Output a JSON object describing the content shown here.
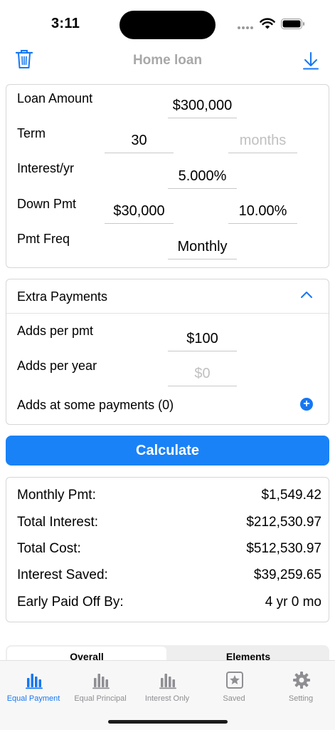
{
  "status_bar": {
    "time": "3:11"
  },
  "nav": {
    "title": "Home loan"
  },
  "loan": {
    "amount_label": "Loan Amount",
    "amount_value": "$300,000",
    "term_label": "Term",
    "term_value": "30",
    "term_months_placeholder": "months",
    "interest_label": "Interest/yr",
    "interest_value": "5.000%",
    "down_label": "Down Pmt",
    "down_amount": "$30,000",
    "down_percent": "10.00%",
    "freq_label": "Pmt Freq",
    "freq_value": "Monthly"
  },
  "extra": {
    "title": "Extra Payments",
    "per_pmt_label": "Adds per pmt",
    "per_pmt_value": "$100",
    "per_year_label": "Adds per year",
    "per_year_placeholder": "$0",
    "some_payments_label": "Adds at some payments (0)"
  },
  "calculate_label": "Calculate",
  "results": [
    {
      "label": "Monthly Pmt:",
      "value": "$1,549.42"
    },
    {
      "label": "Total Interest:",
      "value": "$212,530.97"
    },
    {
      "label": "Total Cost:",
      "value": "$512,530.97"
    },
    {
      "label": "Interest Saved:",
      "value": "$39,259.65"
    },
    {
      "label": "Early Paid Off By:",
      "value": "4 yr 0 mo"
    }
  ],
  "segments": {
    "overall": "Overall",
    "elements": "Elements"
  },
  "tabs": [
    {
      "label": "Equal Payment",
      "icon": "bar-chart-icon"
    },
    {
      "label": "Equal Principal",
      "icon": "bar-chart-icon"
    },
    {
      "label": "Interest Only",
      "icon": "bar-chart-icon"
    },
    {
      "label": "Saved",
      "icon": "star-square-icon"
    },
    {
      "label": "Setting",
      "icon": "gear-icon"
    }
  ],
  "colors": {
    "accent": "#1677f3",
    "button": "#1a82f7",
    "inactive_tab": "#8e8e93"
  }
}
